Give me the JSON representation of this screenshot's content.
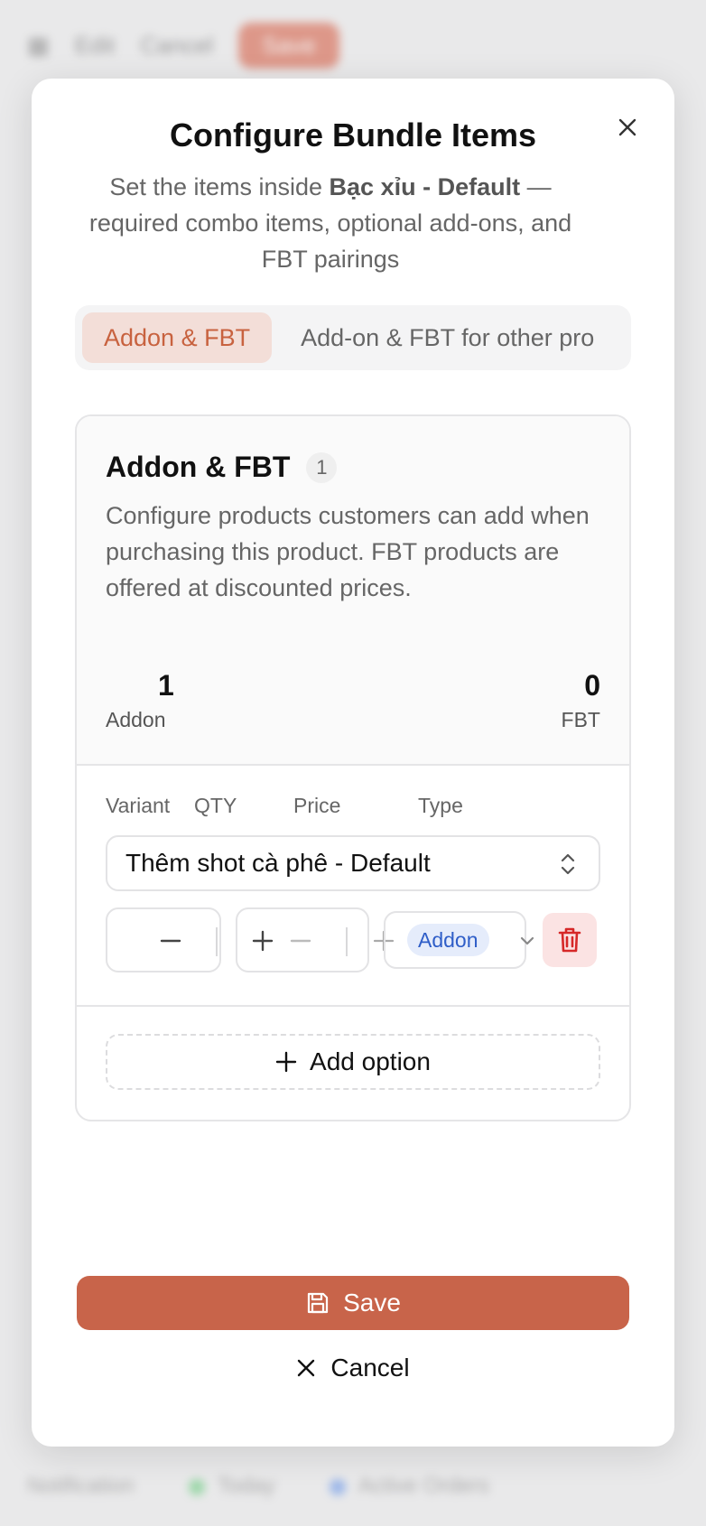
{
  "background": {
    "toolbar": [
      "Edit",
      "Cancel",
      "Save"
    ],
    "footer": [
      "Notification",
      "Today",
      "Active Orders"
    ]
  },
  "modal": {
    "title": "Configure Bundle Items",
    "subtitle_prefix": "Set the items inside ",
    "subtitle_product": "Bạc xỉu - Default",
    "subtitle_suffix": " — required combo items, optional add-ons, and FBT pairings",
    "tabs": [
      {
        "label": "Addon & FBT",
        "active": true
      },
      {
        "label": "Add-on & FBT for other pro",
        "active": false
      }
    ],
    "section": {
      "title": "Addon & FBT",
      "count": "1",
      "description": "Configure products customers can add when purchasing this product. FBT products are offered at discounted prices.",
      "stats": {
        "addon_count": "1",
        "addon_label": "Addon",
        "fbt_count": "0",
        "fbt_label": "FBT"
      },
      "columns": [
        "Variant",
        "QTY",
        "Price",
        "Type"
      ],
      "item": {
        "variant": "Thêm shot cà phê - Default",
        "type": "Addon"
      },
      "add_option_label": "Add option"
    },
    "save_label": "Save",
    "cancel_label": "Cancel"
  },
  "colors": {
    "accent": "#c8644a",
    "tab_active_bg": "#f3ded8",
    "tag_bg": "#e5ecfb",
    "tag_text": "#2f5ec8",
    "danger_bg": "#fbe3e3",
    "danger": "#d62828"
  },
  "icons": [
    "close-icon",
    "chevron-updown-icon",
    "minus-icon",
    "plus-icon",
    "chevron-down-icon",
    "trash-icon",
    "save-icon",
    "x-icon"
  ]
}
